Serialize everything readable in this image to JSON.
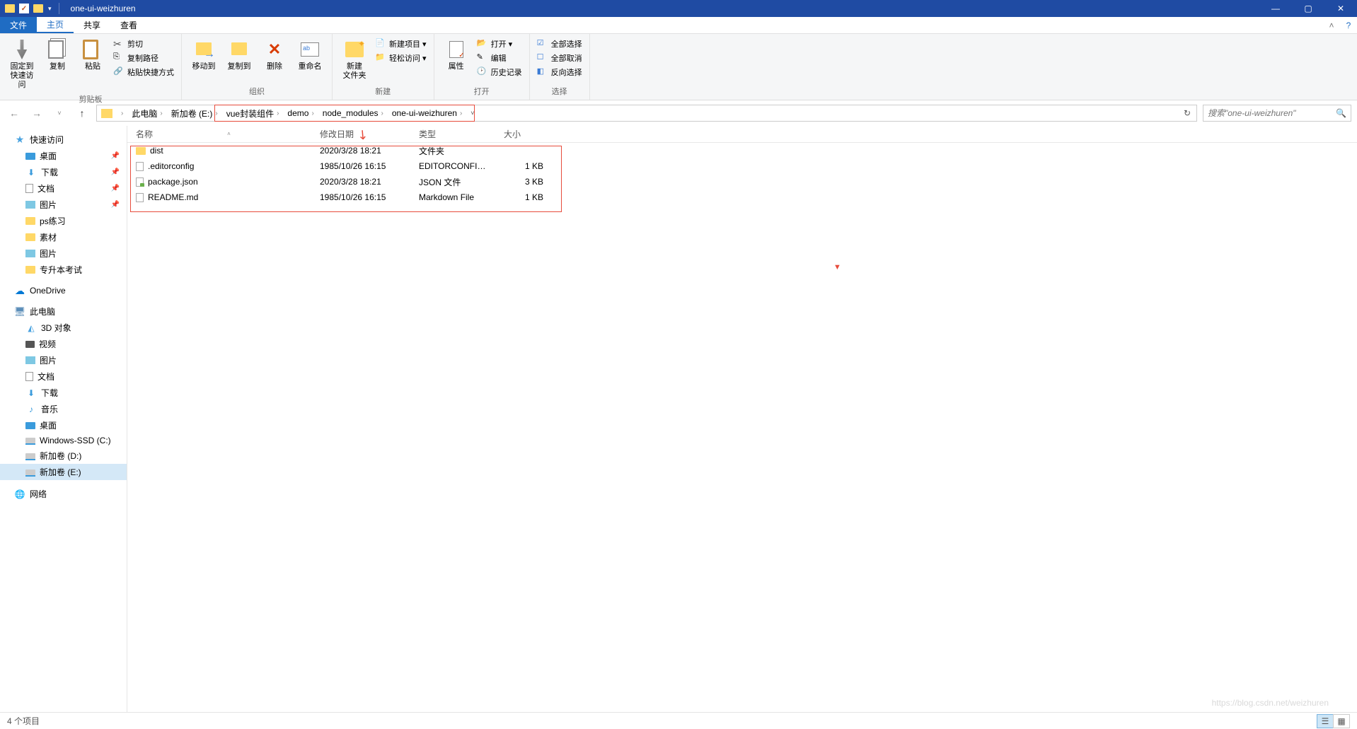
{
  "window": {
    "title": "one-ui-weizhuren"
  },
  "tabs": {
    "file": "文件",
    "home": "主页",
    "share": "共享",
    "view": "查看"
  },
  "ribbon": {
    "clipboard": {
      "label": "剪贴板",
      "pin": "固定到\n快速访问",
      "copy": "复制",
      "paste": "粘贴",
      "cut": "剪切",
      "copypath": "复制路径",
      "pasteshortcut": "粘贴快捷方式"
    },
    "organize": {
      "label": "组织",
      "moveto": "移动到",
      "copyto": "复制到",
      "delete": "删除",
      "rename": "重命名"
    },
    "new": {
      "label": "新建",
      "newfolder": "新建\n文件夹",
      "newitem": "新建项目 ▾",
      "easyaccess": "轻松访问 ▾"
    },
    "open": {
      "label": "打开",
      "properties": "属性",
      "open": "打开 ▾",
      "edit": "编辑",
      "history": "历史记录"
    },
    "select": {
      "label": "选择",
      "selectall": "全部选择",
      "selectnone": "全部取消",
      "invert": "反向选择"
    }
  },
  "breadcrumbs": [
    "此电脑",
    "新加卷 (E:)",
    "vue封装组件",
    "demo",
    "node_modules",
    "one-ui-weizhuren"
  ],
  "search": {
    "placeholder": "搜索\"one-ui-weizhuren\""
  },
  "sidebar": {
    "quick": "快速访问",
    "quick_items": [
      "桌面",
      "下载",
      "文档",
      "图片",
      "ps练习",
      "素材",
      "图片",
      "专升本考试"
    ],
    "onedrive": "OneDrive",
    "thispc": "此电脑",
    "pc_items": [
      "3D 对象",
      "视频",
      "图片",
      "文档",
      "下载",
      "音乐",
      "桌面",
      "Windows-SSD (C:)",
      "新加卷 (D:)",
      "新加卷 (E:)"
    ],
    "network": "网络"
  },
  "columns": {
    "name": "名称",
    "modified": "修改日期",
    "type": "类型",
    "size": "大小"
  },
  "files": [
    {
      "icon": "folder",
      "name": "dist",
      "modified": "2020/3/28 18:21",
      "type": "文件夹",
      "size": ""
    },
    {
      "icon": "file",
      "name": ".editorconfig",
      "modified": "1985/10/26 16:15",
      "type": "EDITORCONFIG ...",
      "size": "1 KB"
    },
    {
      "icon": "json",
      "name": "package.json",
      "modified": "2020/3/28 18:21",
      "type": "JSON 文件",
      "size": "3 KB"
    },
    {
      "icon": "md",
      "name": "README.md",
      "modified": "1985/10/26 16:15",
      "type": "Markdown File",
      "size": "1 KB"
    }
  ],
  "status": {
    "count": "4 个项目"
  },
  "watermark": "https://blog.csdn.net/weizhuren"
}
